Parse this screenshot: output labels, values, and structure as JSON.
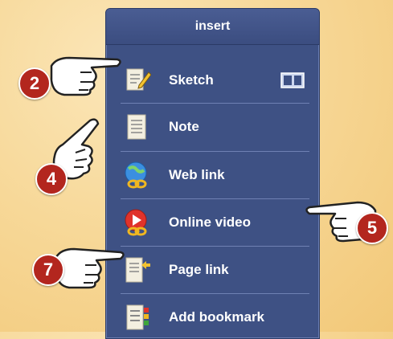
{
  "panel": {
    "title": "insert",
    "items": [
      {
        "label": "Sketch",
        "icon": "sketch-icon"
      },
      {
        "label": "Note",
        "icon": "note-icon"
      },
      {
        "label": "Web link",
        "icon": "web-link-icon"
      },
      {
        "label": "Online video",
        "icon": "online-video-icon"
      },
      {
        "label": "Page link",
        "icon": "page-link-icon"
      },
      {
        "label": "Add bookmark",
        "icon": "add-bookmark-icon"
      }
    ],
    "sketch_toggle_icon": "panel-toggle-icon"
  },
  "callouts": [
    {
      "number": "2"
    },
    {
      "number": "4"
    },
    {
      "number": "5"
    },
    {
      "number": "7"
    }
  ],
  "colors": {
    "panel_bg": "#3e5184",
    "badge_red": "#b3261e",
    "background": "#f7d898"
  }
}
